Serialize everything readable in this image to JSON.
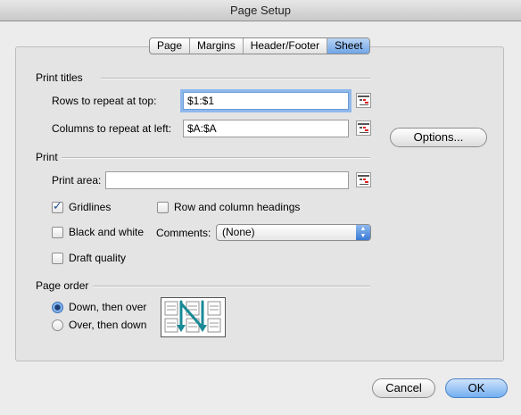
{
  "window": {
    "title": "Page Setup"
  },
  "tabs": [
    {
      "label": "Page"
    },
    {
      "label": "Margins"
    },
    {
      "label": "Header/Footer"
    },
    {
      "label": "Sheet",
      "selected": true
    }
  ],
  "print_titles": {
    "heading": "Print titles",
    "rows_label": "Rows to repeat at top:",
    "rows_value": "$1:$1",
    "cols_label": "Columns to repeat at left:",
    "cols_value": "$A:$A"
  },
  "options_button": "Options...",
  "print": {
    "heading": "Print",
    "area_label": "Print area:",
    "area_value": "",
    "gridlines": {
      "label": "Gridlines",
      "checked": true
    },
    "row_col_headings": {
      "label": "Row and column headings",
      "checked": false
    },
    "black_white": {
      "label": "Black and white",
      "checked": false
    },
    "comments_label": "Comments:",
    "comments_value": "(None)",
    "draft_quality": {
      "label": "Draft quality",
      "checked": false
    }
  },
  "page_order": {
    "heading": "Page order",
    "down_then_over": {
      "label": "Down, then over",
      "selected": true
    },
    "over_then_down": {
      "label": "Over, then down",
      "selected": false
    }
  },
  "buttons": {
    "cancel": "Cancel",
    "ok": "OK"
  },
  "colors": {
    "accent": "#6fa5e6",
    "panel": "#e4e4e4",
    "arrow": "#1a8a96"
  },
  "icons": {
    "range_picker": "collapse-dialog-icon",
    "select_arrows": "up-down-arrows-icon"
  }
}
